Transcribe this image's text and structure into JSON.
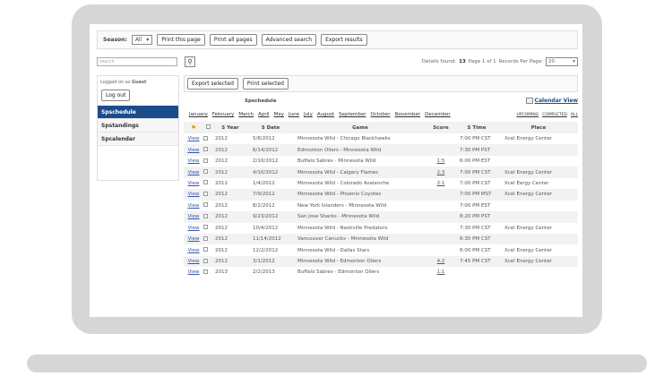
{
  "toolbar": {
    "season_label": "Season:",
    "season_value": "All",
    "print_page": "Print this page",
    "print_all": "Print all pages",
    "advanced_search": "Advanced search",
    "export_results": "Export results"
  },
  "search": {
    "placeholder": "search",
    "details_label": "Details found:",
    "details_count": "13",
    "page_text": "Page 1 of 1",
    "per_page_label": "Records Per Page:",
    "per_page_value": "20"
  },
  "sidebar": {
    "logged_prefix": "Logged on as",
    "user": "Guest",
    "logout": "Log out",
    "items": [
      {
        "label": "Spschedule"
      },
      {
        "label": "Spstandings"
      },
      {
        "label": "Spcalendar"
      }
    ]
  },
  "main": {
    "export_selected": "Export selected",
    "print_selected": "Print selected",
    "title": "Spschedule",
    "calendar_view": "Calendar View",
    "months": [
      "January",
      "February",
      "March",
      "April",
      "May",
      "June",
      "July",
      "August",
      "September",
      "October",
      "November",
      "December"
    ],
    "filters": [
      "UPCOMING",
      "COMPLETED",
      "ALL"
    ],
    "headers": {
      "year": "S Year",
      "date": "S Date",
      "game": "Game",
      "score": "Score",
      "time": "S Time",
      "place": "Place"
    },
    "rows": [
      {
        "view": "View",
        "year": "2012",
        "date": "5/8/2012",
        "game": "Minnesota Wild - Chicago Blackhawks",
        "score": "",
        "time": "7:00 PM CST",
        "place": "Xcel Energy Center"
      },
      {
        "view": "View",
        "year": "2012",
        "date": "6/14/2012",
        "game": "Edmonton Oilers - Minnesota Wild",
        "score": "",
        "time": "7:30 PM PST",
        "place": ""
      },
      {
        "view": "View",
        "year": "2012",
        "date": "2/10/2012",
        "game": "Buffalo Sabres - Minnesota Wild",
        "score": "1:5",
        "time": "6:00 PM EST",
        "place": ""
      },
      {
        "view": "View",
        "year": "2012",
        "date": "4/10/2012",
        "game": "Minnesota Wild - Calgary Flames",
        "score": "2:3",
        "time": "7:00 PM CST",
        "place": "Xcel Energy Center"
      },
      {
        "view": "View",
        "year": "2012",
        "date": "1/4/2012",
        "game": "Minnesota Wild - Colorado Avalanche",
        "score": "2:1",
        "time": "7:00 PM CST",
        "place": "Xcel Eergy Center"
      },
      {
        "view": "View",
        "year": "2012",
        "date": "7/9/2012",
        "game": "Minnesota Wild - Phoenix Coyotes",
        "score": "",
        "time": "7:00 PM MST",
        "place": "Xcel Energy Center"
      },
      {
        "view": "View",
        "year": "2012",
        "date": "8/2/2012",
        "game": "New York Islanders - Minnesota Wild",
        "score": "",
        "time": "7:00 PM EST",
        "place": ""
      },
      {
        "view": "View",
        "year": "2012",
        "date": "9/23/2012",
        "game": "San Jose Sharks - Minnesota Wild",
        "score": "",
        "time": "8:20 PM PST",
        "place": ""
      },
      {
        "view": "View",
        "year": "2012",
        "date": "10/4/2012",
        "game": "Minnesota Wild - Nashville Predators",
        "score": "",
        "time": "7:30 PM CST",
        "place": "Xcel Energy Center"
      },
      {
        "view": "View",
        "year": "2012",
        "date": "11/14/2012",
        "game": "Vancouver Canucks - Minnesota Wild",
        "score": "",
        "time": "6:30 PM CST",
        "place": ""
      },
      {
        "view": "View",
        "year": "2012",
        "date": "12/2/2012",
        "game": "Minnesota Wild - Dallas Stars",
        "score": "",
        "time": "8:00 PM CST",
        "place": "Xcel Energy Center"
      },
      {
        "view": "View",
        "year": "2012",
        "date": "3/1/2012",
        "game": "Minnesota Wild - Edmonton Oilers",
        "score": "4:2",
        "time": "7:45 PM CST",
        "place": "Xcel Energy Center"
      },
      {
        "view": "View",
        "year": "2013",
        "date": "2/2/2013",
        "game": "Buffalo Sabres - Edmonton Oilers",
        "score": "1:1",
        "time": "",
        "place": ""
      }
    ]
  }
}
